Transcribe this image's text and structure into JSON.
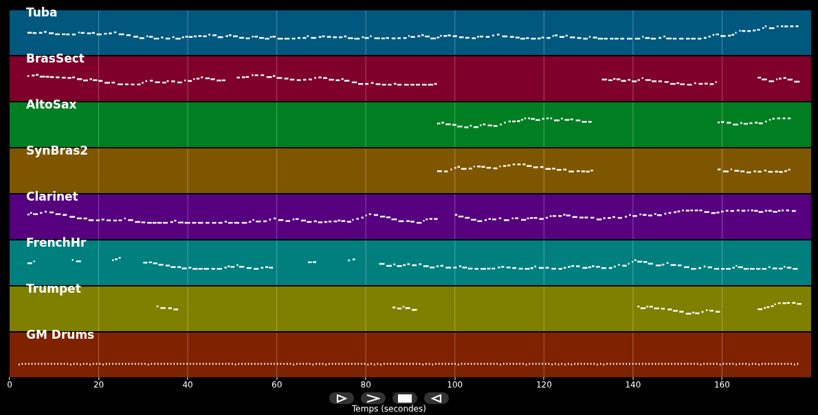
{
  "tracks": [
    {
      "name": "Tuba",
      "color": "#00587f"
    },
    {
      "name": "BrasSect",
      "color": "#7f002b"
    },
    {
      "name": "AltoSax",
      "color": "#007f22"
    },
    {
      "name": "SynBras2",
      "color": "#7f5600"
    },
    {
      "name": "Clarinet",
      "color": "#56007f"
    },
    {
      "name": "FrenchHr",
      "color": "#007f7f"
    },
    {
      "name": "Trumpet",
      "color": "#7f7f00"
    },
    {
      "name": "GM Drums",
      "color": "#7f2200"
    }
  ],
  "x_axis": {
    "ticks": [
      "0",
      "20",
      "40",
      "60",
      "80",
      "100",
      "120",
      "140",
      "160"
    ],
    "label": "Temps (secondes)"
  },
  "controls": [
    {
      "kind": "play"
    },
    {
      "kind": "forward"
    },
    {
      "kind": "stop"
    },
    {
      "kind": "back"
    }
  ]
}
